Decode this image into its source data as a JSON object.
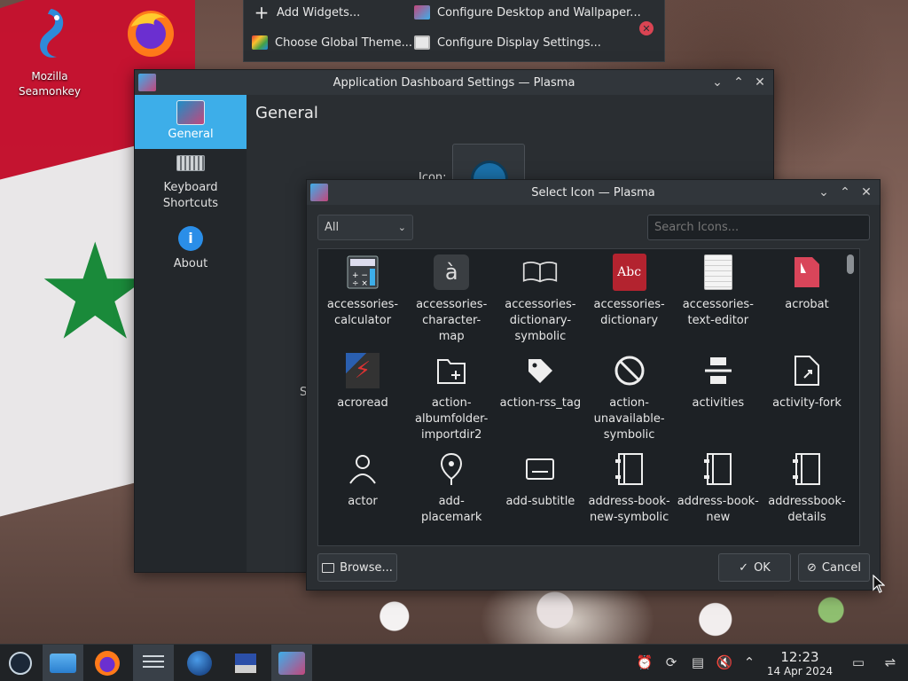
{
  "desktop": {
    "icons": [
      {
        "label": "Mozilla\nSeamonkey",
        "icon": "seamonkey-icon"
      },
      {
        "label": "",
        "icon": "firefox-icon"
      }
    ]
  },
  "context_menu": {
    "items": [
      {
        "label": "Add Widgets...",
        "icon": "plus-icon"
      },
      {
        "label": "Configure Desktop and Wallpaper...",
        "icon": "desktop-config-icon"
      },
      {
        "label": "Choose Global Theme...",
        "icon": "theme-icon"
      },
      {
        "label": "Configure Display Settings...",
        "icon": "display-icon"
      }
    ]
  },
  "settings_window": {
    "title": "Application Dashboard Settings — Plasma",
    "sidebar": [
      {
        "label": "General",
        "icon": "general-icon",
        "active": true
      },
      {
        "label": "Keyboard\nShortcuts",
        "icon": "keyboard-icon",
        "active": false
      },
      {
        "label": "About",
        "icon": "info-icon",
        "active": false
      }
    ],
    "page_title": "General",
    "icon_label_fragment": "Icon:",
    "partial_label": "S"
  },
  "select_icon_dialog": {
    "title": "Select Icon — Plasma",
    "filter_value": "All",
    "search_placeholder": "Search Icons...",
    "icons": [
      {
        "label": "accessories-\ncalculator",
        "icon": "calculator-icon"
      },
      {
        "label": "accessories-\ncharacter-\nmap",
        "icon": "character-map-icon"
      },
      {
        "label": "accessories-\ndictionary-\nsymbolic",
        "icon": "open-book-icon"
      },
      {
        "label": "accessories-\ndictionary",
        "icon": "dictionary-icon"
      },
      {
        "label": "accessories-\ntext-editor",
        "icon": "text-editor-icon"
      },
      {
        "label": "acrobat",
        "icon": "acrobat-icon"
      },
      {
        "label": "acroread",
        "icon": "acroread-icon"
      },
      {
        "label": "action-\nalbumfolder-\nimportdir2",
        "icon": "folder-add-icon"
      },
      {
        "label": "action-rss_tag",
        "icon": "tag-icon"
      },
      {
        "label": "action-\nunavailable-\nsymbolic",
        "icon": "unavailable-icon"
      },
      {
        "label": "activities",
        "icon": "activities-icon"
      },
      {
        "label": "activity-fork",
        "icon": "activity-fork-icon"
      },
      {
        "label": "actor",
        "icon": "actor-icon"
      },
      {
        "label": "add-\nplacemark",
        "icon": "placemark-icon"
      },
      {
        "label": "add-subtitle",
        "icon": "subtitle-icon"
      },
      {
        "label": "address-book-\nnew-symbolic",
        "icon": "address-book-icon"
      },
      {
        "label": "address-book-\nnew",
        "icon": "address-book-icon"
      },
      {
        "label": "addressbook-\ndetails",
        "icon": "address-book-icon"
      }
    ],
    "browse_label": "Browse...",
    "ok_label": "OK",
    "cancel_label": "Cancel"
  },
  "taskbar": {
    "apps": [
      "steam-icon",
      "file-manager-icon",
      "firefox-icon",
      "settings-icon",
      "browser-globe-icon",
      "remote-desktop-icon",
      "plasma-settings-icon"
    ],
    "time": "12:23",
    "date": "14 Apr 2024"
  }
}
